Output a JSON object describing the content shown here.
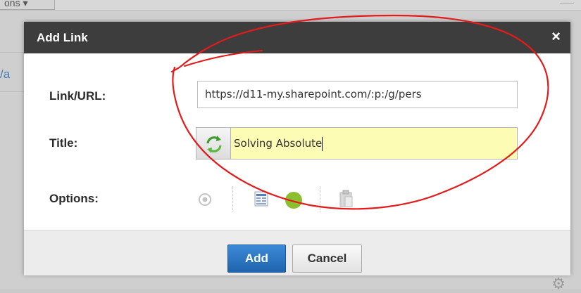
{
  "background": {
    "tab_label": "ons ▾",
    "link_fragment": "/a"
  },
  "dialog": {
    "title": "Add Link",
    "close_symbol": "×",
    "fields": {
      "url_label": "Link/URL:",
      "url_value": "https://d11-my.sharepoint.com/:p:/g/pers",
      "title_label": "Title:",
      "title_value": "Solving Absolute",
      "options_label": "Options:"
    },
    "option_icons": [
      "radio-target-icon",
      "document-icon",
      "green-dot-icon",
      "clipboard-icon"
    ],
    "buttons": {
      "add": "Add",
      "cancel": "Cancel"
    }
  },
  "colors": {
    "header_bg": "#3d3d3d",
    "add_button": "#2a74c3",
    "title_highlight": "#fcfcb4",
    "annotation_red": "#e21b1b"
  }
}
